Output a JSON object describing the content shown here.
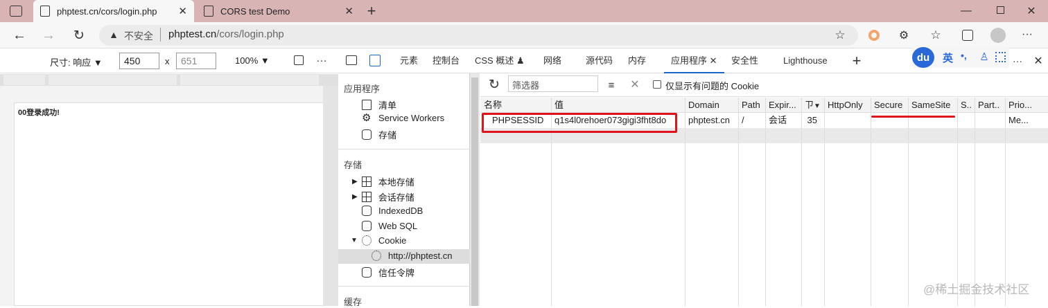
{
  "browser": {
    "tabs": [
      {
        "title": "phptest.cn/cors/login.php",
        "active": true
      },
      {
        "title": "CORS test Demo",
        "active": false
      }
    ],
    "insecure_label": "不安全",
    "url_domain": "phptest.cn",
    "url_path": "/cors/login.php"
  },
  "device_toolbar": {
    "size_label": "尺寸: 响应",
    "width": "450",
    "times": "x",
    "height": "651",
    "zoom": "100%"
  },
  "page": {
    "content": "00登录成功!"
  },
  "devtools": {
    "tabs": [
      "元素",
      "控制台",
      "CSS 概述",
      "网络",
      "源代码",
      "内存",
      "应用程序",
      "安全性",
      "Lighthouse"
    ],
    "active_tab": "应用程序"
  },
  "sidebar": {
    "app_header": "应用程序",
    "app_items": [
      "清单",
      "Service Workers",
      "存储"
    ],
    "storage_header": "存储",
    "storage_items": [
      "本地存储",
      "会话存储",
      "IndexedDB",
      "Web SQL",
      "Cookie",
      "http://phptest.cn",
      "信任令牌"
    ],
    "cache_header": "缓存"
  },
  "cookies": {
    "filter_placeholder": "筛选器",
    "only_issues_label": "仅显示有问题的 Cookie",
    "columns": [
      "名称",
      "值",
      "Domain",
      "Path",
      "Expir...",
      "ㄗ",
      "HttpOnly",
      "Secure",
      "SameSite",
      "S..",
      "Part..",
      "Prio..."
    ],
    "rows": [
      [
        "PHPSESSID",
        "q1s4l0rehoer073gigi3fht8do",
        "phptest.cn",
        "/",
        "会话",
        "35",
        "",
        "",
        "",
        "",
        "",
        "Me..."
      ]
    ]
  },
  "ime": {
    "logo": "du",
    "lang": "英",
    "punct": "•,"
  },
  "watermark": "@稀土掘金技术社区",
  "colors": {
    "tabbar": "#d9b4b4",
    "highlight": "#e0121c",
    "accent": "#1a66c5"
  }
}
